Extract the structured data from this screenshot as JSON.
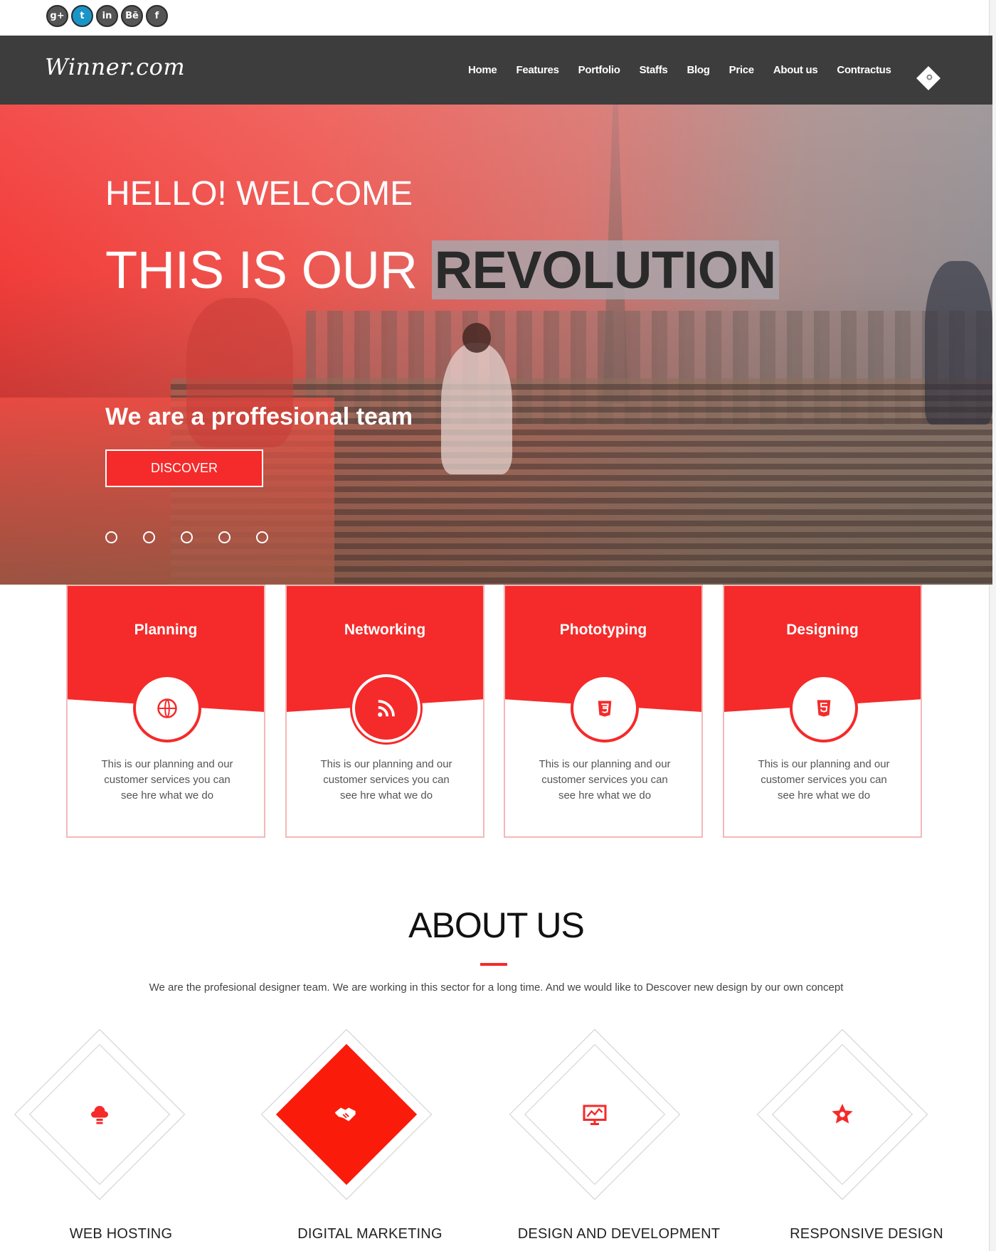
{
  "social": {
    "icons": [
      {
        "name": "google-plus-icon",
        "glyph": "g+"
      },
      {
        "name": "twitter-icon",
        "glyph": "t"
      },
      {
        "name": "linkedin-icon",
        "glyph": "in"
      },
      {
        "name": "behance-icon",
        "glyph": "Bē"
      },
      {
        "name": "facebook-icon",
        "glyph": "f"
      }
    ]
  },
  "nav": {
    "logo": "Winner.com",
    "menu": [
      "Home",
      "Features",
      "Portfolio",
      "Staffs",
      "Blog",
      "Price",
      "About us",
      "Contractus"
    ],
    "search_icon": "search-icon"
  },
  "hero": {
    "greeting": "HELLO! WELCOME",
    "headline_plain": "THIS IS OUR",
    "headline_highlight": "REVOLUTION",
    "subline": "We are a proffesional team",
    "button": "DISCOVER",
    "slide_count": 5
  },
  "features": [
    {
      "title": "Planning",
      "icon": "globe-icon",
      "glyph": "🌐",
      "desc": "This is our planning and our customer services you can see hre what we do"
    },
    {
      "title": "Networking",
      "icon": "rss-icon",
      "glyph": "☰",
      "desc": "This is our planning and our customer services you can see hre what we do"
    },
    {
      "title": "Phototyping",
      "icon": "css3-icon",
      "glyph": "3",
      "desc": "This is our planning and our customer services you can see hre what we do"
    },
    {
      "title": "Designing",
      "icon": "html5-icon",
      "glyph": "5",
      "desc": "This is our planning and our customer services you can see hre what we do"
    }
  ],
  "about": {
    "title": "ABOUT US",
    "text": "We are the profesional designer team. We are working in this sector for a long time. And we would like to Descover new design by our own concept"
  },
  "services": [
    {
      "label": "WEB HOSTING",
      "icon": "cloud-server-icon",
      "glyph": "☁"
    },
    {
      "label": "DIGITAL MARKETING",
      "icon": "handshake-icon",
      "glyph": "✋"
    },
    {
      "label": "DESIGN AND DEVELOPMENT",
      "icon": "monitor-chart-icon",
      "glyph": "▣"
    },
    {
      "label": "RESPONSIVE DESIGN",
      "icon": "star-icon",
      "glyph": "✩"
    }
  ],
  "colors": {
    "accent": "#f52a2a",
    "nav_bg": "#3d3d3d"
  }
}
